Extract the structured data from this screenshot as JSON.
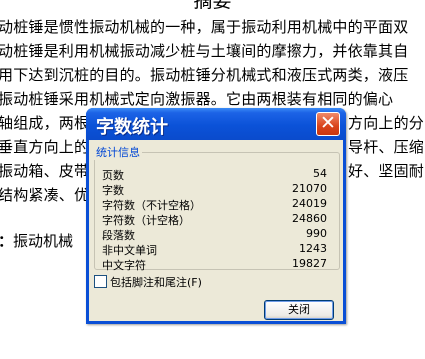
{
  "document": {
    "title": "摘要",
    "lines": [
      "动桩锤是惯性振动机械的一种，属于振动利用机械中的平面双",
      "动桩锤是利用机械振动减少桩与土壤间的摩擦力，并依靠其自",
      "用下达到沉桩的目的。振动桩锤分机械式和液压式两类，液压",
      "  振动桩锤采用机械式定向激振器。它由两根装有相同的偏心",
      "轴组成，两根",
      "垂直方向上的",
      "振动箱、皮带",
      "结构紧凑、优"
    ],
    "right_fragments": [
      "方向上的分",
      "导杆、压缩",
      "好、坚固耐"
    ],
    "keywords_label": "：",
    "keywords_text": "振动机械"
  },
  "dialog": {
    "title": "字数统计",
    "close_glyph": "✕",
    "group_label": "统计信息",
    "stats": [
      {
        "label": "页数",
        "value": "54"
      },
      {
        "label": "字数",
        "value": "21070"
      },
      {
        "label": "字符数（不计空格）",
        "value": "24019"
      },
      {
        "label": "字符数（计空格）",
        "value": "24860"
      },
      {
        "label": "段落数",
        "value": "990"
      },
      {
        "label": "非中文单词",
        "value": "1243"
      },
      {
        "label": "中文字符",
        "value": "19827"
      }
    ],
    "checkbox_label": "包括脚注和尾注(F)",
    "checkbox_checked": false,
    "close_button_label": "关闭"
  }
}
